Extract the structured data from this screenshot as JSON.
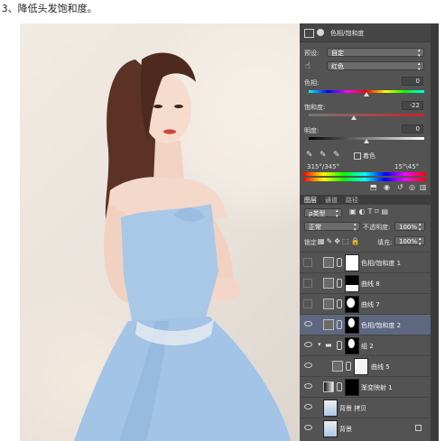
{
  "caption": "3、降低头发饱和度。",
  "properties": {
    "title": "色相/饱和度",
    "preset_label": "预设:",
    "preset_value": "自定",
    "channel_value": "红色",
    "hue_label": "色相:",
    "hue_value": "0",
    "saturation_label": "饱和度:",
    "saturation_value": "-22",
    "lightness_label": "明度:",
    "lightness_value": "0",
    "colorize_label": "着色",
    "range_left": "315°/345°",
    "range_right": "15°\\45°"
  },
  "layers_panel": {
    "tabs": [
      "图层",
      "通道",
      "路径"
    ],
    "filter_value": "ρ类型",
    "blend_mode": "正常",
    "opacity_label": "不透明度:",
    "opacity_value": "100%",
    "lock_label": "锁定:",
    "fill_label": "填充:",
    "fill_value": "100%",
    "layers": [
      {
        "name": "色相/饱和度 1",
        "visible": false,
        "selected": false
      },
      {
        "name": "曲线 8",
        "visible": false,
        "selected": false
      },
      {
        "name": "曲线 7",
        "visible": false,
        "selected": false
      },
      {
        "name": "色相/饱和度 2",
        "visible": true,
        "selected": true
      },
      {
        "name": "组 2",
        "visible": true,
        "selected": false
      },
      {
        "name": "曲线 5",
        "visible": true,
        "selected": false
      },
      {
        "name": "渐变映射 1",
        "visible": true,
        "selected": false
      },
      {
        "name": "背景 拷贝",
        "visible": true,
        "selected": false
      },
      {
        "name": "背景",
        "visible": true,
        "selected": false
      }
    ]
  }
}
